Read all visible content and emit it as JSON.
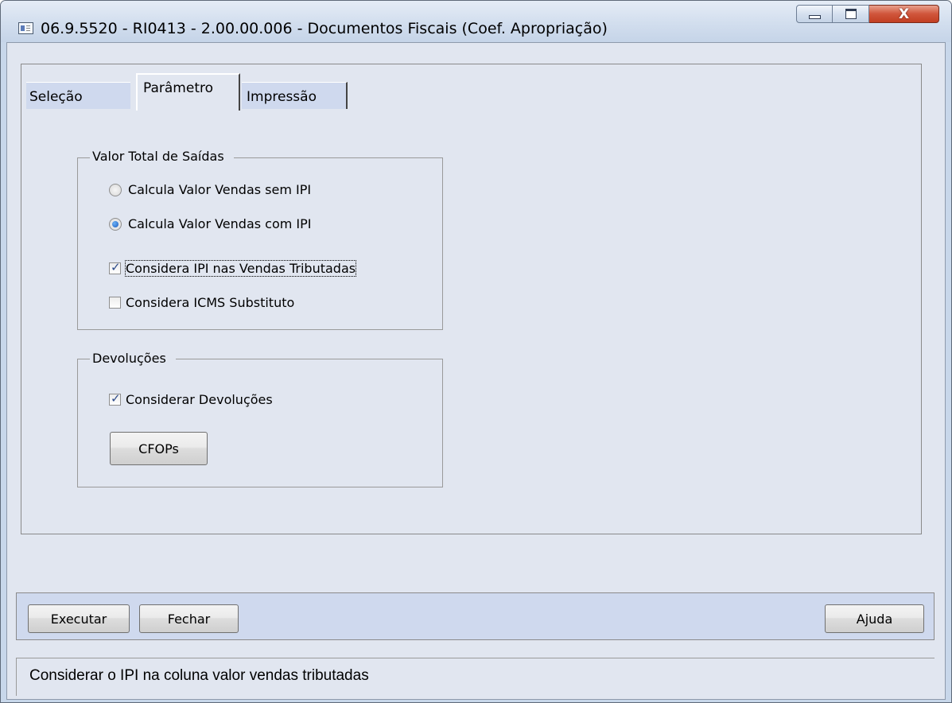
{
  "window": {
    "title": "06.9.5520 - RI0413 - 2.00.00.006 - Documentos Fiscais (Coef. Apropriação)",
    "close_glyph": "X"
  },
  "tabs": [
    {
      "label": "Seleção",
      "selected": false
    },
    {
      "label": "Parâmetro",
      "selected": true
    },
    {
      "label": "Impressão",
      "selected": false
    }
  ],
  "valor_total_saidas": {
    "title": "Valor Total de Saídas",
    "options": [
      {
        "label": "Calcula Valor Vendas sem IPI",
        "checked": false
      },
      {
        "label": "Calcula Valor Vendas com IPI",
        "checked": true
      }
    ],
    "checkboxes": [
      {
        "label": "Considera IPI nas Vendas Tributadas",
        "checked": true,
        "focused": true
      },
      {
        "label": "Considera ICMS Substituto",
        "checked": false
      }
    ]
  },
  "devolucoes": {
    "title": "Devoluções",
    "checkbox": {
      "label": "Considerar Devoluções",
      "checked": true
    },
    "button": "CFOPs"
  },
  "footer": {
    "executar": "Executar",
    "fechar": "Fechar",
    "ajuda": "Ajuda"
  },
  "status": {
    "text": "Considerar o IPI na coluna valor vendas tributadas"
  }
}
